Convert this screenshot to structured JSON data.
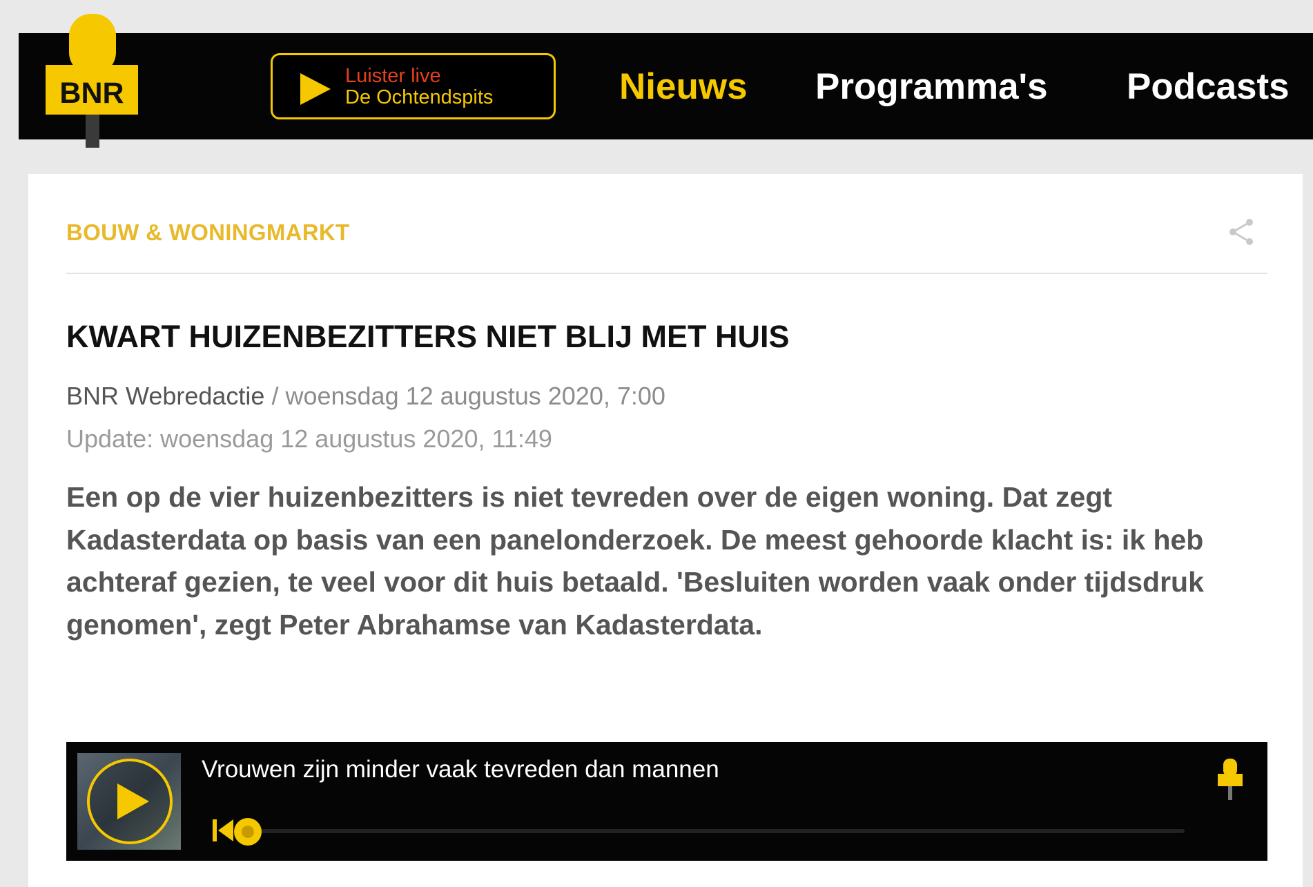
{
  "header": {
    "logo_text": "BNR",
    "live": {
      "line1": "Luister live",
      "line2": "De Ochtendspits"
    },
    "nav": [
      "Nieuws",
      "Programma's",
      "Podcasts"
    ]
  },
  "article": {
    "category": "BOUW & WONINGMARKT",
    "title": "KWART HUIZENBEZITTERS NIET BLIJ MET HUIS",
    "author": "BNR Webredactie",
    "published": " / woensdag 12 augustus 2020, 7:00",
    "updated": "Update: woensdag 12 augustus 2020, 11:49",
    "intro": "Een op de vier huizenbezitters is niet tevreden over de eigen woning. Dat zegt Kadasterdata op basis van een panelonderzoek. De meest gehoorde klacht is: ik heb achteraf gezien, te veel voor dit huis betaald. 'Besluiten worden vaak onder tijdsdruk genomen', zegt Peter Abrahamse van Kadasterdata."
  },
  "player": {
    "title": "Vrouwen zijn minder vaak tevreden dan mannen",
    "progress": 0
  },
  "colors": {
    "brand_yellow": "#f5c800",
    "category_yellow": "#e8b92b",
    "live_red": "#e8401c",
    "topbar": "#050505"
  },
  "icons": [
    "microphone-logo-icon",
    "play-icon",
    "share-icon",
    "skip-back-icon",
    "progress-knob-icon"
  ]
}
